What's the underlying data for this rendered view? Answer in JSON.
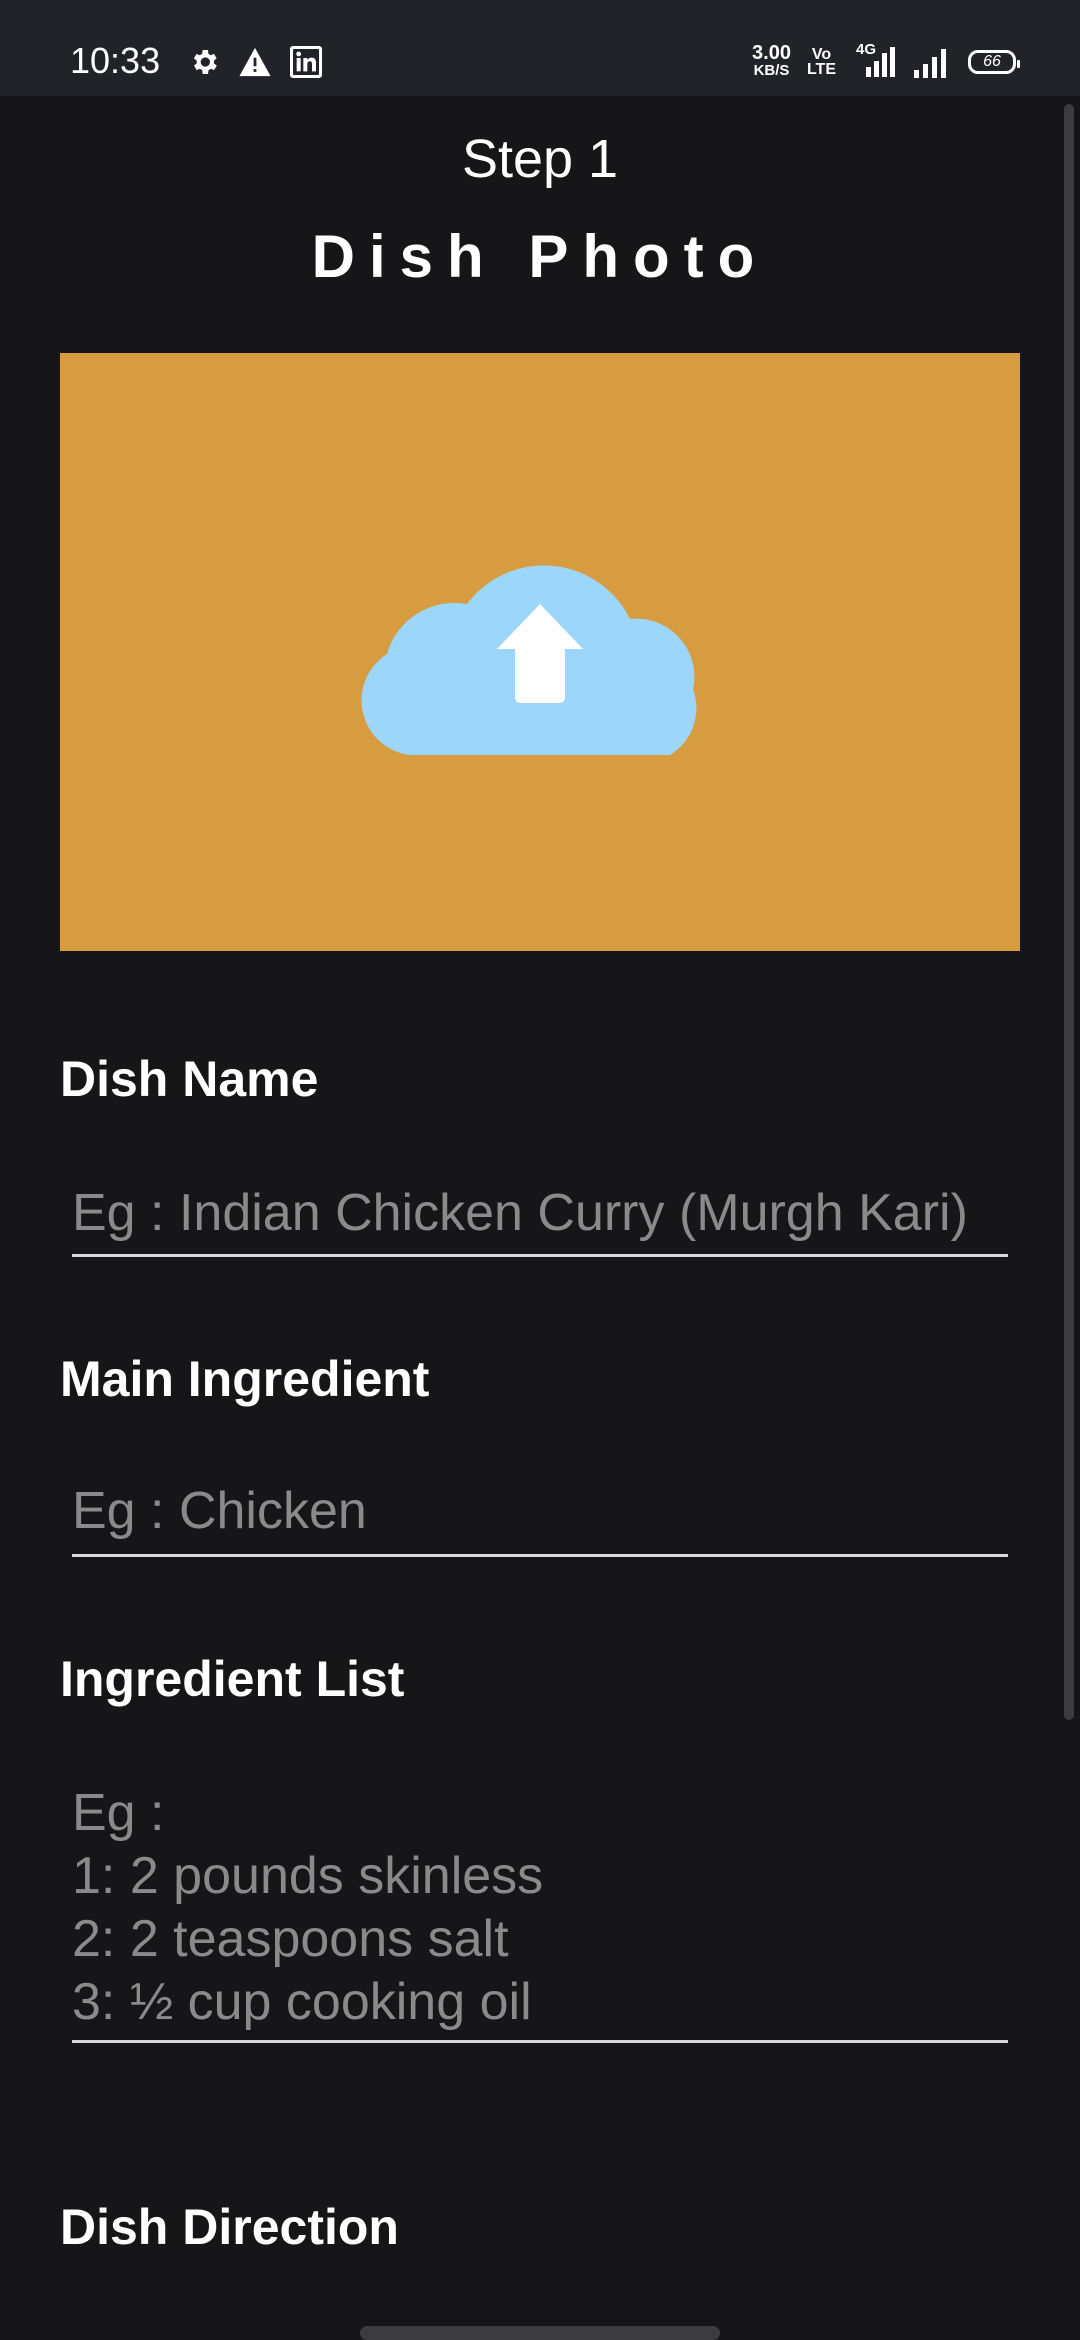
{
  "status_bar": {
    "time": "10:33",
    "speed_value": "3.00",
    "speed_unit": "KB/S",
    "volte_top": "Vo",
    "volte_bottom": "LTE",
    "network": "4G",
    "battery": "66",
    "left_icons": [
      "settings-icon",
      "warning-icon",
      "linkedin-icon"
    ]
  },
  "header": {
    "step": "Step 1",
    "title": "Dish Photo"
  },
  "upload": {
    "icon": "cloud-upload-icon",
    "background": "#d79c40",
    "cloud_color": "#9dd6fb"
  },
  "form": {
    "dish_name": {
      "label": "Dish Name",
      "placeholder": "Eg : Indian Chicken Curry (Murgh Kari)"
    },
    "main_ingredient": {
      "label": "Main Ingredient",
      "placeholder": "Eg : Chicken"
    },
    "ingredient_list": {
      "label": "Ingredient List",
      "placeholder": "Eg :\n1: 2 pounds skinless\n2: 2 teaspoons salt\n3: ½ cup cooking oil"
    },
    "dish_direction": {
      "label": "Dish Direction"
    }
  }
}
